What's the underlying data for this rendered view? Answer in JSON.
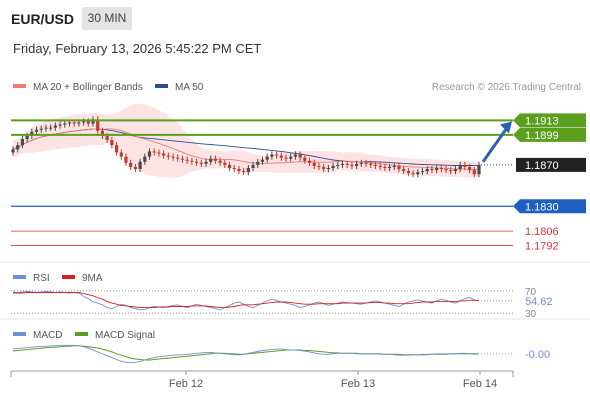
{
  "header": {
    "symbol": "EUR/USD",
    "timeframe": "30 MIN",
    "datetime": "Friday, February 13, 2026 5:45:22 PM CET"
  },
  "legend": {
    "ma20_label": "MA 20 + Bollinger Bands",
    "ma50_label": "MA 50",
    "copyright": "Research © 2026 Trading Central"
  },
  "colors": {
    "ma20": "#f07a7a",
    "ma50": "#2f4e8c",
    "resistance": "#5aa01e",
    "support": "#1f5fbf",
    "support_minor": "#d9373d",
    "price_tag": "#222222",
    "bollinger_fill": "#fde3e3",
    "candle_up": "#4a4a4a",
    "candle_down": "#c0392b",
    "arrow": "#2a62ad",
    "rsi": "#6f8fd8",
    "rsi_ma": "#d62020",
    "macd": "#6f8fd8",
    "macd_signal": "#5aa01e"
  },
  "chart_data": [
    {
      "type": "candlestick",
      "name": "price",
      "ylim": [
        1.178,
        1.1925
      ],
      "levels": [
        {
          "value": 1.1913,
          "label": "1.1913",
          "kind": "resistance"
        },
        {
          "value": 1.1899,
          "label": "1.1899",
          "kind": "resistance"
        },
        {
          "value": 1.187,
          "label": "1.1870",
          "kind": "current"
        },
        {
          "value": 1.183,
          "label": "1.1830",
          "kind": "support"
        },
        {
          "value": 1.1806,
          "label": "1.1806",
          "kind": "support_minor"
        },
        {
          "value": 1.1792,
          "label": "1.1792",
          "kind": "support_minor"
        }
      ],
      "x_ticks": [
        "Feb 12",
        "Feb 13",
        "Feb 14"
      ],
      "close": [
        1.1885,
        1.1889,
        1.1895,
        1.1898,
        1.1902,
        1.1904,
        1.1905,
        1.1906,
        1.1906,
        1.1908,
        1.1909,
        1.191,
        1.1911,
        1.191,
        1.1911,
        1.1912,
        1.191,
        1.1914,
        1.1903,
        1.1898,
        1.1894,
        1.1889,
        1.1882,
        1.1878,
        1.1872,
        1.1868,
        1.1866,
        1.1873,
        1.1878,
        1.1883,
        1.1882,
        1.1881,
        1.1879,
        1.1878,
        1.1877,
        1.1876,
        1.1875,
        1.1874,
        1.1873,
        1.1872,
        1.1871,
        1.1873,
        1.1876,
        1.1874,
        1.1872,
        1.187,
        1.1867,
        1.1866,
        1.1864,
        1.1863,
        1.1867,
        1.187,
        1.1873,
        1.1875,
        1.1878,
        1.188,
        1.1879,
        1.1877,
        1.1876,
        1.1878,
        1.188,
        1.1877,
        1.1874,
        1.1872,
        1.1869,
        1.1868,
        1.1866,
        1.1867,
        1.1869,
        1.187,
        1.1871,
        1.187,
        1.1869,
        1.1871,
        1.1872,
        1.1871,
        1.187,
        1.1869,
        1.1868,
        1.1867,
        1.1868,
        1.1869,
        1.1866,
        1.1864,
        1.1862,
        1.1861,
        1.1863,
        1.1864,
        1.1866,
        1.1865,
        1.1867,
        1.1866,
        1.1865,
        1.1864,
        1.1866,
        1.187,
        1.1868,
        1.1865,
        1.1861,
        1.187
      ]
    },
    {
      "type": "line",
      "name": "RSI",
      "ylim": [
        25,
        75
      ],
      "levels": [
        70,
        30
      ],
      "level_labels": [
        "70",
        "30"
      ],
      "last_value_label": "54.62",
      "series": [
        {
          "name": "RSI",
          "values": [
            68,
            67,
            68,
            69,
            68,
            67,
            68,
            69,
            68,
            67,
            68,
            67,
            66,
            67,
            66,
            60,
            56,
            50,
            48,
            45,
            40,
            38,
            42,
            46,
            44,
            40,
            38,
            36,
            37,
            40,
            42,
            41,
            40,
            42,
            44,
            45,
            42,
            40,
            43,
            46,
            44,
            42,
            40,
            38,
            36,
            40,
            44,
            48,
            50,
            46,
            42,
            40,
            44,
            48,
            52,
            55,
            53,
            50,
            48,
            46,
            44,
            40,
            42,
            45,
            48,
            50,
            47,
            44,
            46,
            48,
            50,
            49,
            48,
            47,
            46,
            48,
            50,
            52,
            50,
            48,
            46,
            44,
            42,
            46,
            50,
            52,
            54,
            52,
            50,
            48,
            52,
            55,
            53,
            50,
            48,
            52,
            56,
            58,
            54,
            52
          ]
        },
        {
          "name": "9MA",
          "values": [
            66,
            66,
            66,
            67,
            67,
            67,
            67,
            67,
            67,
            67,
            67,
            67,
            67,
            67,
            67,
            65,
            63,
            61,
            58,
            55,
            51,
            48,
            46,
            44,
            43,
            42,
            41,
            40,
            40,
            40,
            40,
            41,
            41,
            41,
            42,
            42,
            42,
            42,
            43,
            43,
            43,
            43,
            42,
            41,
            40,
            40,
            41,
            42,
            44,
            45,
            45,
            45,
            46,
            47,
            48,
            49,
            50,
            50,
            50,
            49,
            48,
            47,
            46,
            46,
            46,
            47,
            47,
            47,
            47,
            47,
            48,
            48,
            48,
            48,
            48,
            48,
            49,
            49,
            49,
            48,
            48,
            47,
            47,
            47,
            47,
            48,
            49,
            50,
            50,
            50,
            51,
            51,
            51,
            51,
            51,
            52,
            52,
            53,
            53,
            53
          ]
        }
      ]
    },
    {
      "type": "line",
      "name": "MACD",
      "ylim": [
        -0.003,
        0.0025
      ],
      "last_value_label": "-0.00",
      "series": [
        {
          "name": "MACD",
          "values": [
            0.001,
            0.0011,
            0.0012,
            0.0013,
            0.0014,
            0.0015,
            0.0016,
            0.0016,
            0.0017,
            0.0017,
            0.0018,
            0.0018,
            0.0018,
            0.0018,
            0.0017,
            0.0015,
            0.0012,
            0.0008,
            0.0004,
            0.0,
            -0.0004,
            -0.0008,
            -0.0012,
            -0.0016,
            -0.0018,
            -0.0019,
            -0.0018,
            -0.0016,
            -0.0013,
            -0.001,
            -0.0008,
            -0.0006,
            -0.0005,
            -0.0004,
            -0.0003,
            -0.0002,
            -0.0002,
            -0.0001,
            0.0,
            0.0001,
            0.0002,
            0.0003,
            0.0003,
            0.0002,
            0.0001,
            0.0,
            -0.0001,
            -0.0002,
            -0.0002,
            -0.0001,
            0.0001,
            0.0003,
            0.0005,
            0.0007,
            0.0008,
            0.0009,
            0.001,
            0.001,
            0.0009,
            0.0008,
            0.0008,
            0.0007,
            0.0006,
            0.0004,
            0.0002,
            0.0,
            -0.0001,
            -0.0001,
            0.0,
            0.0001,
            0.0001,
            0.0001,
            0.0001,
            0.0,
            0.0,
            0.0,
            0.0,
            0.0,
            -0.0001,
            -0.0001,
            -0.0001,
            -0.0002,
            -0.0003,
            -0.0003,
            -0.0003,
            -0.0002,
            -0.0002,
            -0.0001,
            -0.0001,
            -0.0001,
            0.0,
            0.0,
            0.0,
            0.0,
            0.0,
            0.0001,
            0.0001,
            0.0,
            -0.0001,
            0.0
          ]
        },
        {
          "name": "MACD Signal",
          "values": [
            0.0006,
            0.0007,
            0.0008,
            0.0009,
            0.001,
            0.0011,
            0.0012,
            0.0013,
            0.0014,
            0.0014,
            0.0015,
            0.0016,
            0.0016,
            0.0017,
            0.0017,
            0.0016,
            0.0015,
            0.0014,
            0.0012,
            0.001,
            0.0007,
            0.0004,
            0.0,
            -0.0003,
            -0.0006,
            -0.0009,
            -0.0011,
            -0.0012,
            -0.0013,
            -0.0013,
            -0.0012,
            -0.0011,
            -0.001,
            -0.0009,
            -0.0008,
            -0.0007,
            -0.0006,
            -0.0005,
            -0.0004,
            -0.0003,
            -0.0002,
            -0.0001,
            0.0,
            0.0001,
            0.0001,
            0.0001,
            0.0,
            0.0,
            -0.0001,
            -0.0001,
            0.0,
            0.0001,
            0.0002,
            0.0003,
            0.0004,
            0.0005,
            0.0006,
            0.0007,
            0.0008,
            0.0008,
            0.0008,
            0.0008,
            0.0007,
            0.0007,
            0.0006,
            0.0005,
            0.0004,
            0.0003,
            0.0002,
            0.0002,
            0.0001,
            0.0001,
            0.0001,
            0.0001,
            0.0,
            0.0,
            0.0,
            0.0,
            0.0,
            -0.0001,
            -0.0001,
            -0.0001,
            -0.0001,
            -0.0002,
            -0.0002,
            -0.0002,
            -0.0002,
            -0.0002,
            -0.0002,
            -0.0001,
            -0.0001,
            -0.0001,
            -0.0001,
            0.0,
            0.0,
            0.0,
            0.0,
            0.0,
            0.0,
            0.0
          ]
        }
      ]
    }
  ],
  "indicators": {
    "rsi_label": "RSI",
    "rsi_ma_label": "9MA",
    "macd_label": "MACD",
    "macd_signal_label": "MACD Signal"
  }
}
